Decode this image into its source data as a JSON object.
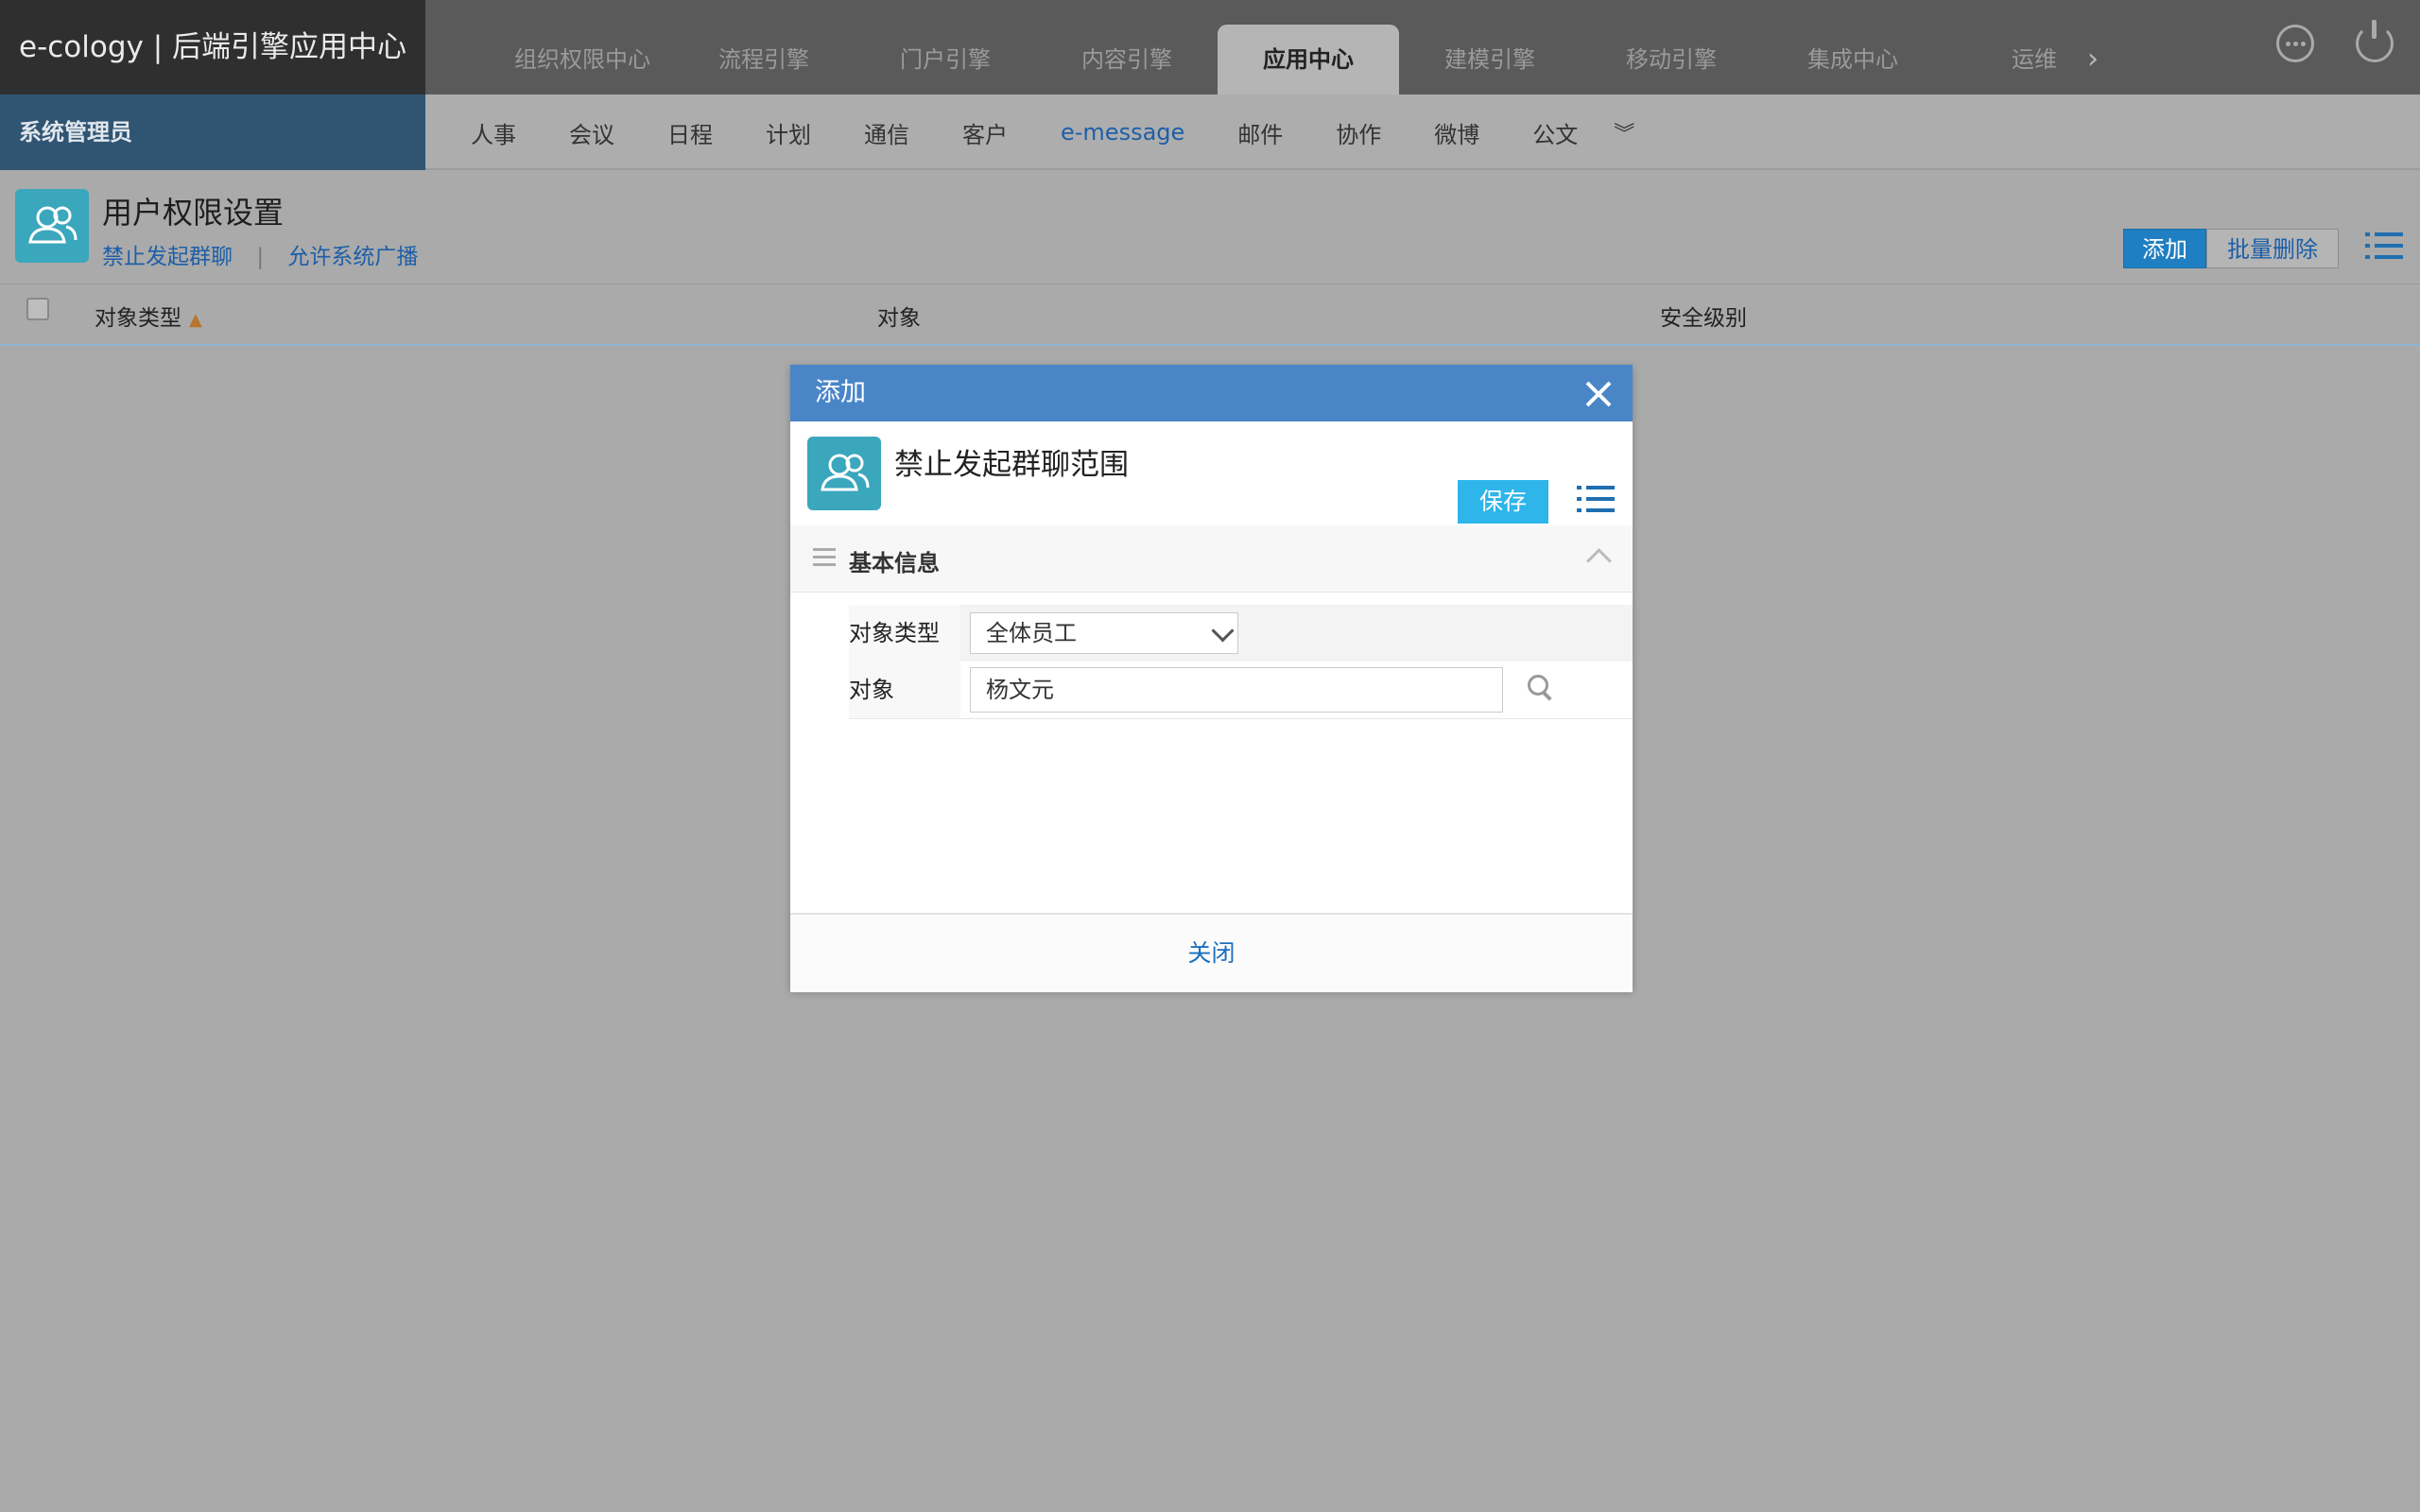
{
  "app": {
    "brand": "e-cology | 后端引擎应用中心",
    "role": "系统管理员"
  },
  "top_nav": [
    {
      "label": "组织权限中心",
      "active": false
    },
    {
      "label": "流程引擎",
      "active": false
    },
    {
      "label": "门户引擎",
      "active": false
    },
    {
      "label": "内容引擎",
      "active": false
    },
    {
      "label": "应用中心",
      "active": true
    },
    {
      "label": "建模引擎",
      "active": false
    },
    {
      "label": "移动引擎",
      "active": false
    },
    {
      "label": "集成中心",
      "active": false
    },
    {
      "label": "运维",
      "active": false
    }
  ],
  "sub_nav": [
    {
      "label": "人事",
      "active": false
    },
    {
      "label": "会议",
      "active": false
    },
    {
      "label": "日程",
      "active": false
    },
    {
      "label": "计划",
      "active": false
    },
    {
      "label": "通信",
      "active": false
    },
    {
      "label": "客户",
      "active": false
    },
    {
      "label": "e-message",
      "active": true
    },
    {
      "label": "邮件",
      "active": false
    },
    {
      "label": "协作",
      "active": false
    },
    {
      "label": "微博",
      "active": false
    },
    {
      "label": "公文",
      "active": false
    }
  ],
  "page": {
    "title": "用户权限设置",
    "links": [
      "禁止发起群聊",
      "允许系统广播"
    ],
    "add_label": "添加",
    "batch_delete_label": "批量删除"
  },
  "table": {
    "columns": [
      "对象类型",
      "对象",
      "安全级别"
    ]
  },
  "modal": {
    "title": "添加",
    "subtitle": "禁止发起群聊范围",
    "save_label": "保存",
    "section_title": "基本信息",
    "fields": {
      "type_label": "对象类型",
      "type_value": "全体员工",
      "object_label": "对象",
      "object_value": "杨文元"
    },
    "close_label": "关闭"
  },
  "colors": {
    "accent": "#4a86c7",
    "save": "#2eb5ea",
    "app_icon": "#3aa7bd",
    "link": "#1d5fa8"
  }
}
